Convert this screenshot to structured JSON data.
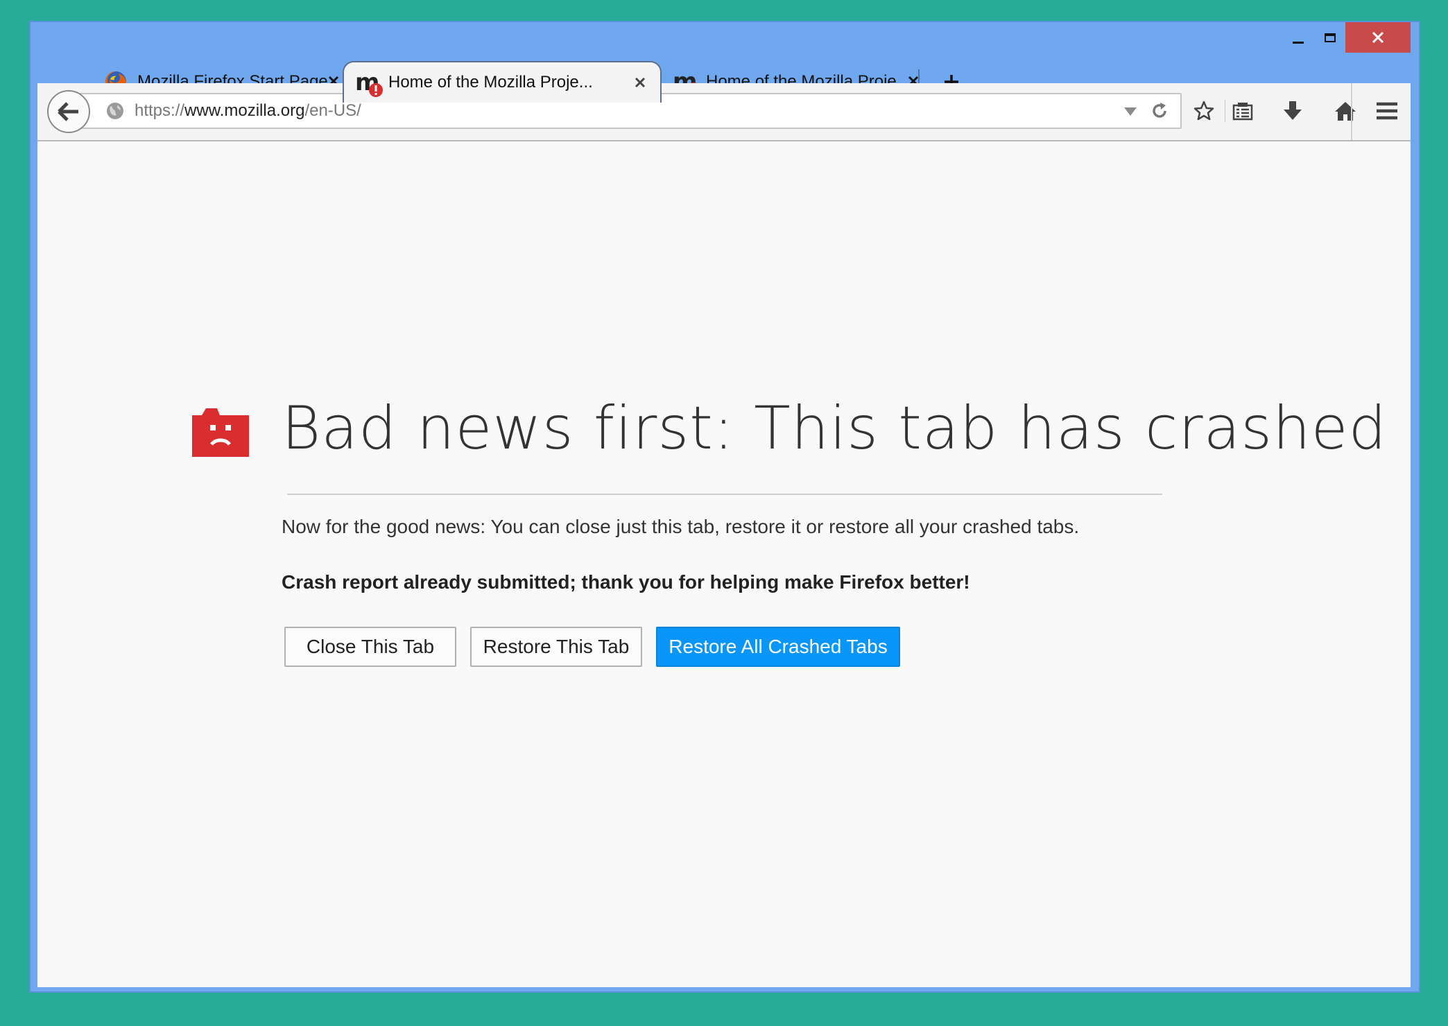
{
  "window": {
    "controls": {
      "minimize": "minimize",
      "maximize": "maximize",
      "close": "close"
    }
  },
  "tabs": [
    {
      "title": "Mozilla Firefox Start Page",
      "icon": "firefox-logo-icon",
      "active": false
    },
    {
      "title": "Home of the Mozilla Proje...",
      "icon": "mozilla-crashed-icon",
      "active": true
    },
    {
      "title": "Home of the Mozilla Proje...",
      "icon": "mozilla-crashed-icon",
      "active": false
    }
  ],
  "newtab_label": "+",
  "navbar": {
    "url_prefix": "https://",
    "url_host": "www.mozilla.org",
    "url_path": "/en-US/"
  },
  "content": {
    "heading": "Bad news first: This tab has crashed",
    "message": "Now for the good news: You can close just this tab, restore it or restore all your crashed tabs.",
    "report_status": "Crash report already submitted; thank you for helping make Firefox better!",
    "buttons": {
      "close_tab": "Close This Tab",
      "restore_tab": "Restore This Tab",
      "restore_all": "Restore All Crashed Tabs"
    }
  },
  "colors": {
    "desktop": "#25ab98",
    "titlebar": "#6fa8ee",
    "close_button": "#c94a4a",
    "primary_button": "#0996f8",
    "sad_icon": "#d92d2f"
  }
}
